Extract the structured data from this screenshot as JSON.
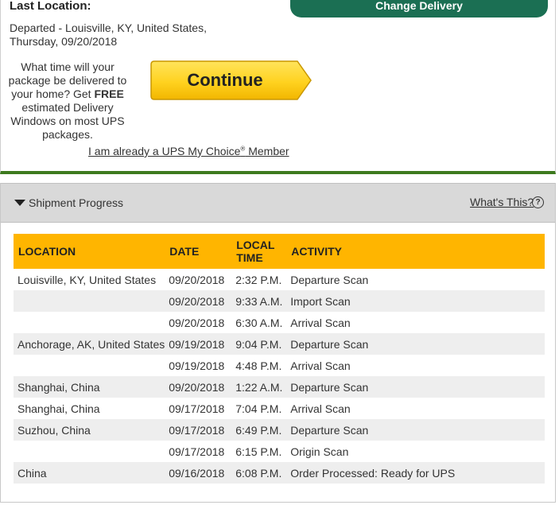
{
  "top": {
    "last_location_label": "Last Location:",
    "departed_line": "Departed - Louisville, KY, United States,",
    "date_line": "Thursday, 09/20/2018",
    "change_delivery": "Change Delivery",
    "promo_before": "What time will your package be delivered to your home? Get ",
    "promo_bold": "FREE",
    "promo_after": " estimated Delivery Windows on most UPS packages.",
    "continue": "Continue",
    "member_link_a": "I am already a UPS My Choice",
    "member_link_reg": "®",
    "member_link_b": " Member"
  },
  "progress": {
    "section_title": "Shipment Progress",
    "whats_this": "What's This?",
    "help_icon": "?",
    "headers": [
      "LOCATION",
      "DATE",
      "LOCAL TIME",
      "ACTIVITY"
    ],
    "rows": [
      {
        "location": "Louisville,  KY,  United States",
        "date": "09/20/2018",
        "time": "2:32 P.M.",
        "activity": "Departure Scan"
      },
      {
        "location": "",
        "date": "09/20/2018",
        "time": "9:33 A.M.",
        "activity": "Import Scan"
      },
      {
        "location": "",
        "date": "09/20/2018",
        "time": "6:30 A.M.",
        "activity": "Arrival Scan"
      },
      {
        "location": "Anchorage,  AK,  United States",
        "date": "09/19/2018",
        "time": "9:04 P.M.",
        "activity": "Departure Scan"
      },
      {
        "location": "",
        "date": "09/19/2018",
        "time": "4:48 P.M.",
        "activity": "Arrival Scan"
      },
      {
        "location": "Shanghai,  China",
        "date": "09/20/2018",
        "time": "1:22 A.M.",
        "activity": "Departure Scan"
      },
      {
        "location": "Shanghai,  China",
        "date": "09/17/2018",
        "time": "7:04 P.M.",
        "activity": "Arrival Scan"
      },
      {
        "location": "Suzhou,  China",
        "date": "09/17/2018",
        "time": "6:49 P.M.",
        "activity": "Departure Scan"
      },
      {
        "location": "",
        "date": "09/17/2018",
        "time": "6:15 P.M.",
        "activity": "Origin Scan"
      },
      {
        "location": "China",
        "date": "09/16/2018",
        "time": "6:08 P.M.",
        "activity": "Order Processed: Ready for UPS"
      }
    ]
  },
  "colors": {
    "table_header": "#ffb500",
    "continue_button": "#ffd83a",
    "change_delivery_button": "#1b6f53",
    "panel_border_green": "#3d7a1e"
  }
}
